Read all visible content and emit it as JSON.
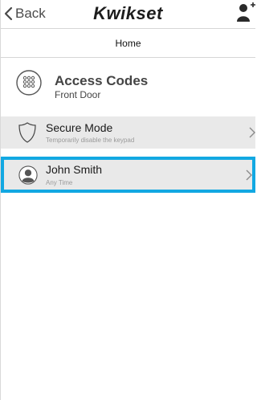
{
  "navbar": {
    "back_label": "Back",
    "logo_text": "Kwikset"
  },
  "subnav": {
    "title": "Home"
  },
  "header": {
    "title": "Access Codes",
    "subtitle": "Front Door"
  },
  "rows": [
    {
      "title": "Secure Mode",
      "subtitle": "Temporarily disable the keypad",
      "icon": "shield-icon"
    },
    {
      "title": "John Smith",
      "subtitle": "Any Time",
      "icon": "user-avatar-icon"
    }
  ],
  "colors": {
    "highlight": "#12a8e2",
    "row_bg": "#e9e9e9"
  }
}
